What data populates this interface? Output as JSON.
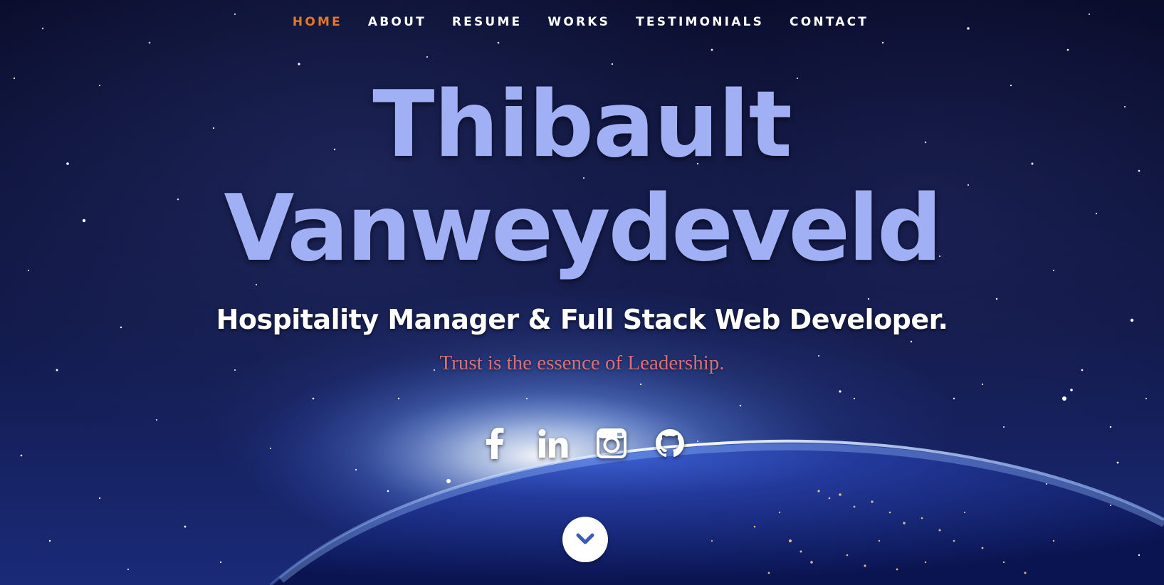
{
  "nav": {
    "items": [
      {
        "label": "HOME",
        "active": true
      },
      {
        "label": "ABOUT",
        "active": false
      },
      {
        "label": "RESUME",
        "active": false
      },
      {
        "label": "WORKS",
        "active": false
      },
      {
        "label": "TESTIMONIALS",
        "active": false
      },
      {
        "label": "CONTACT",
        "active": false
      }
    ],
    "active_color": "#e8771e",
    "text_color": "#ffffff"
  },
  "hero": {
    "name_line1": "Thibault",
    "name_line2": "Vanweydeveld",
    "subtitle": "Hospitality Manager & Full Stack Web Developer.",
    "tagline": "Trust is the essence of Leadership.",
    "name_color": "#a1b0f5",
    "tagline_color": "#d4707a"
  },
  "social": {
    "icons": [
      "facebook-icon",
      "linkedin-icon",
      "instagram-icon",
      "github-icon"
    ]
  },
  "scroll": {
    "icon": "chevron-down-icon",
    "icon_color": "#3a5cb0"
  }
}
